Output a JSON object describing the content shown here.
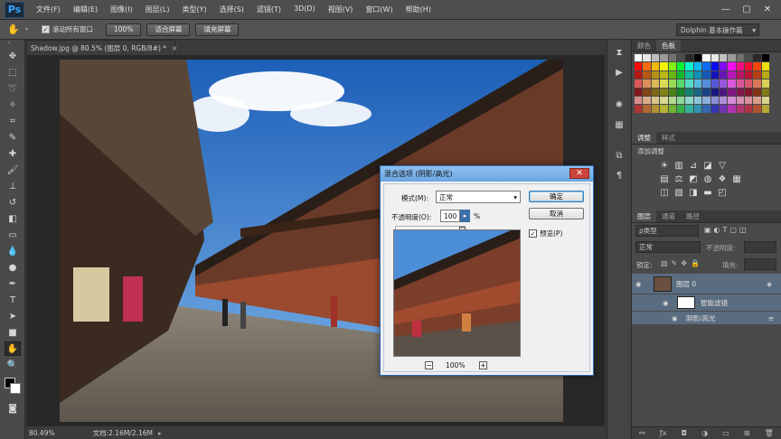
{
  "app": {
    "logo": "Ps",
    "menu": [
      "文件(F)",
      "编辑(E)",
      "图像(I)",
      "图层(L)",
      "类型(Y)",
      "选择(S)",
      "滤镜(T)",
      "3D(D)",
      "视图(V)",
      "窗口(W)",
      "帮助(H)"
    ],
    "window_controls": {
      "minimize": "—",
      "maximize": "▢",
      "close": "✕"
    }
  },
  "options_bar": {
    "tool_icon": "hand-icon",
    "scroll_all_label": "滚动所有窗口",
    "scroll_all_checked": true,
    "btn_100": "100%",
    "btn_fit": "适合屏幕",
    "btn_fill": "填充屏幕",
    "workspace": "Dolphin 基本操作篇"
  },
  "tools": [
    "move-icon",
    "marquee-icon",
    "lasso-icon",
    "magic-wand-icon",
    "crop-icon",
    "eyedropper-icon",
    "healing-brush-icon",
    "brush-icon",
    "clone-stamp-icon",
    "history-brush-icon",
    "eraser-icon",
    "gradient-icon",
    "blur-icon",
    "dodge-icon",
    "pen-icon",
    "type-icon",
    "path-selection-icon",
    "rectangle-icon",
    "hand-icon",
    "zoom-icon"
  ],
  "document": {
    "tab_title": "Shadow.jpg @ 80.5% (图层 0, RGB/8#) *",
    "tab_close": "×",
    "status_zoom": "80.49%",
    "status_doc": "文档:2.16M/2.16M"
  },
  "swatches_panel": {
    "tabs": [
      "颜色",
      "色板"
    ],
    "active_tab": "色板"
  },
  "adjustments_panel": {
    "tabs": [
      "调整",
      "样式"
    ],
    "active_tab": "调整",
    "add_label": "添加调整"
  },
  "layers_panel": {
    "tabs": [
      "图层",
      "通道",
      "路径"
    ],
    "active_tab": "图层",
    "filter_kind": "ρ类型",
    "blend_mode": "正常",
    "opacity_label": "不透明度:",
    "lock_label": "锁定:",
    "fill_label": "填充:",
    "layers": [
      {
        "name": "图层 0"
      },
      {
        "name": "智能滤镜"
      },
      {
        "name": "阴影/高光"
      }
    ]
  },
  "dialog": {
    "title": "混合选项 (阴影/高光)",
    "close": "✕",
    "mode_label": "模式(M):",
    "mode_value": "正常",
    "opacity_label": "不透明度(O):",
    "opacity_value": "100",
    "opacity_unit": "%",
    "opacity_level": 1.0,
    "ok_label": "确定",
    "cancel_label": "取消",
    "preview_label": "预览(P)",
    "preview_checked": true,
    "zoom_minus": "−",
    "zoom_value": "100%",
    "zoom_plus": "+"
  },
  "colors": {
    "menubar_bg": "#4e4e4e",
    "panel_bg": "#4a4a4a",
    "accent": "#31a8ff",
    "dialog_title": "#6aa6e3"
  }
}
